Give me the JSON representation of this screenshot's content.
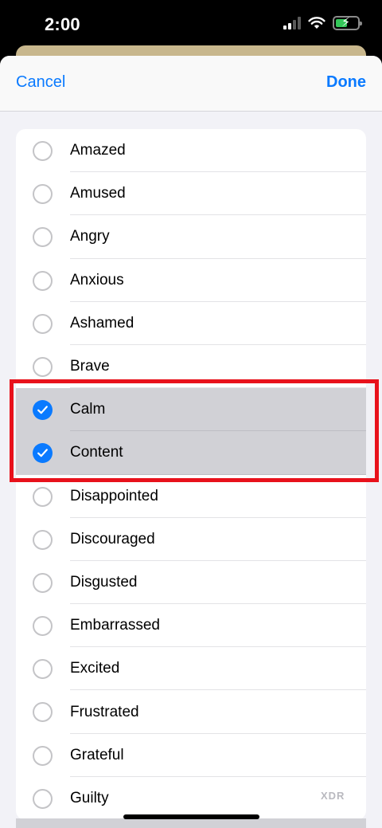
{
  "status_bar": {
    "time": "2:00"
  },
  "header": {
    "cancel_label": "Cancel",
    "done_label": "Done"
  },
  "emotions": [
    {
      "label": "Amazed",
      "checked": false
    },
    {
      "label": "Amused",
      "checked": false
    },
    {
      "label": "Angry",
      "checked": false
    },
    {
      "label": "Anxious",
      "checked": false
    },
    {
      "label": "Ashamed",
      "checked": false
    },
    {
      "label": "Brave",
      "checked": false
    },
    {
      "label": "Calm",
      "checked": true
    },
    {
      "label": "Content",
      "checked": true
    },
    {
      "label": "Disappointed",
      "checked": false
    },
    {
      "label": "Discouraged",
      "checked": false
    },
    {
      "label": "Disgusted",
      "checked": false
    },
    {
      "label": "Embarrassed",
      "checked": false
    },
    {
      "label": "Excited",
      "checked": false
    },
    {
      "label": "Frustrated",
      "checked": false
    },
    {
      "label": "Grateful",
      "checked": false
    },
    {
      "label": "Guilty",
      "checked": false
    }
  ],
  "watermark": "XDR",
  "colors": {
    "accent": "#0a7aff",
    "highlight": "#e8111b",
    "selected_row": "#d1d1d6"
  }
}
